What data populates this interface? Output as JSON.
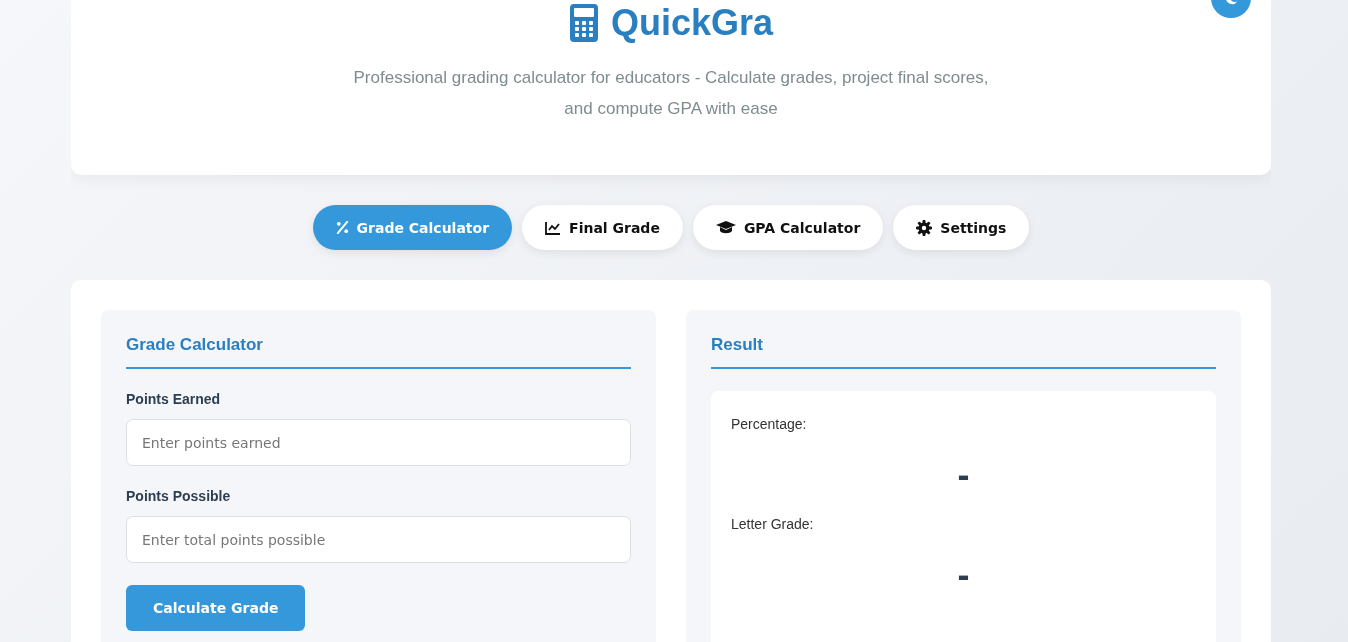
{
  "header": {
    "title": "QuickGra",
    "subtitle": "Professional grading calculator for educators - Calculate grades, project final scores, and compute GPA with ease"
  },
  "tabs": [
    {
      "label": "Grade Calculator",
      "kind": "percent",
      "selected": true
    },
    {
      "label": "Final Grade",
      "kind": "chart",
      "selected": false
    },
    {
      "label": "GPA Calculator",
      "kind": "cap",
      "selected": false
    },
    {
      "label": "Settings",
      "kind": "gear",
      "selected": false
    }
  ],
  "form": {
    "title": "Grade Calculator",
    "fields": [
      {
        "label": "Points Earned",
        "placeholder": "Enter points earned"
      },
      {
        "label": "Points Possible",
        "placeholder": "Enter total points possible"
      }
    ],
    "button": "Calculate Grade"
  },
  "result": {
    "title": "Result",
    "items": [
      {
        "label": "Percentage:",
        "value": "-"
      },
      {
        "label": "Letter Grade:",
        "value": "-"
      }
    ]
  }
}
